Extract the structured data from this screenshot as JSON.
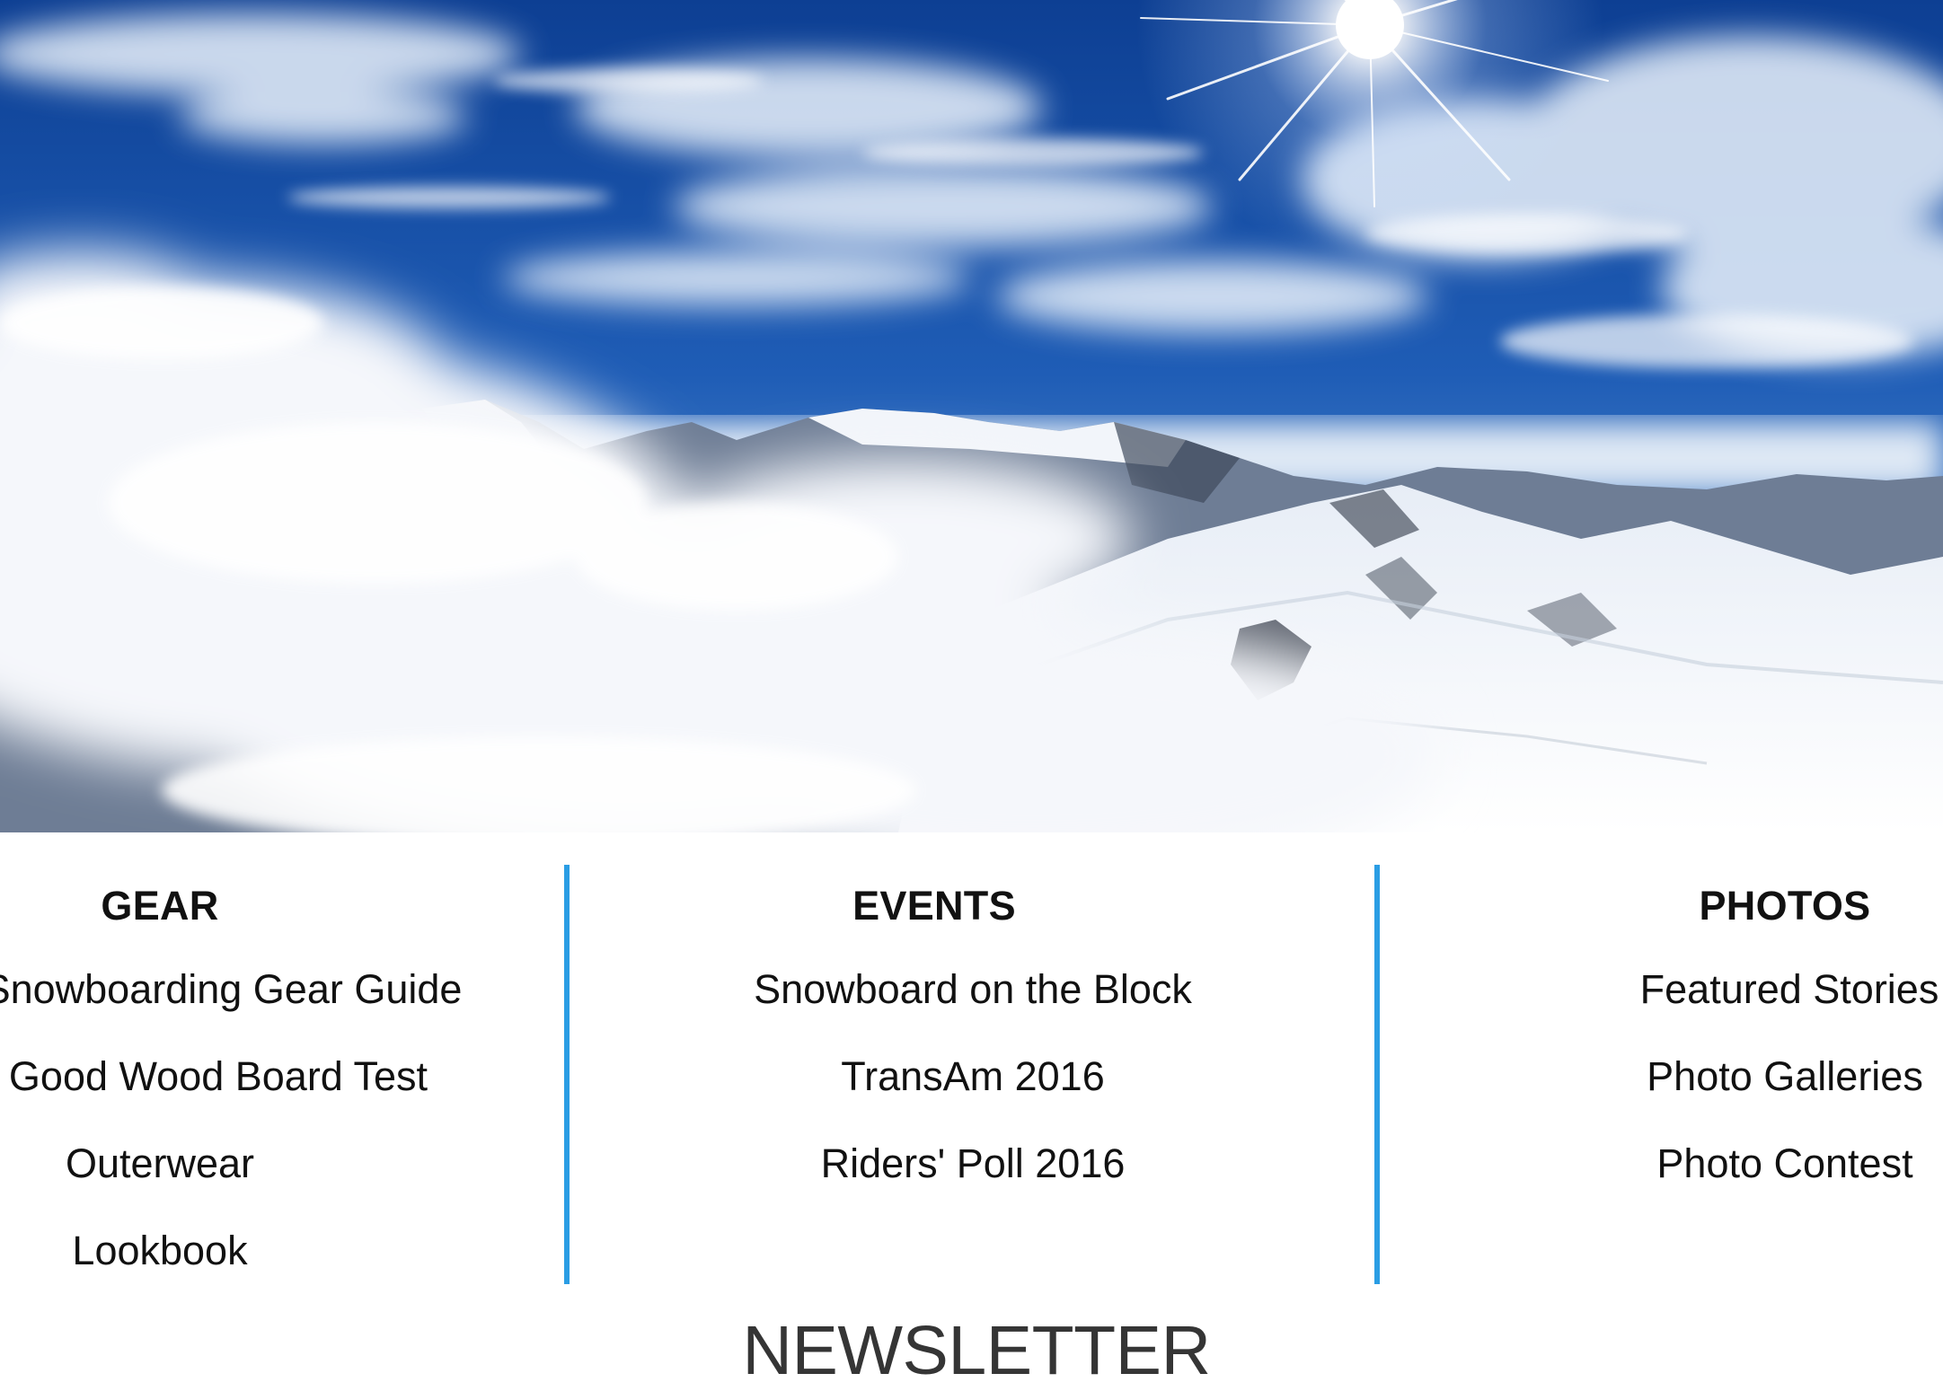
{
  "hero": {
    "image": "snowy-mountain-panorama",
    "colors": {
      "sky": "#1a4fa5",
      "snow": "#f3f6fa"
    }
  },
  "columns": [
    {
      "id": "gear",
      "heading": "GEAR",
      "items": [
        "Snowboarding Gear Guide",
        "Good Wood Board Test",
        "Outerwear",
        "Lookbook"
      ]
    },
    {
      "id": "events",
      "heading": "EVENTS",
      "items": [
        "Snowboard on the Block",
        "TransAm 2016",
        "Riders' Poll 2016"
      ]
    },
    {
      "id": "photos",
      "heading": "PHOTOS",
      "items": [
        "Featured Stories",
        "Photo Galleries",
        "Photo Contest"
      ]
    }
  ],
  "accent_color": "#2a9de4",
  "newsletter": {
    "title": "NEWSLETTER"
  }
}
